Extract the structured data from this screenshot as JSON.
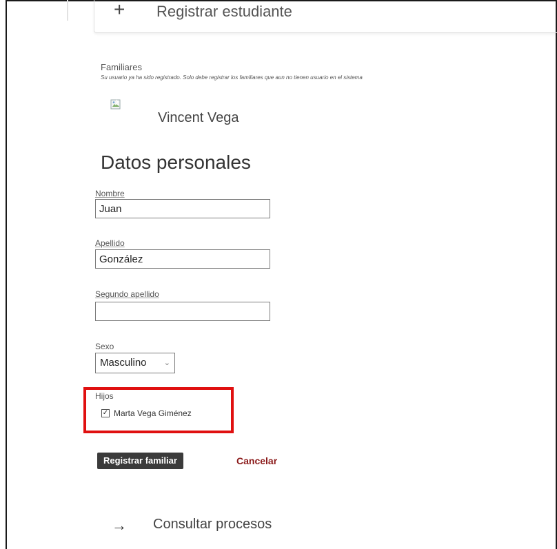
{
  "top_card": {
    "label": "Registrar estudiante"
  },
  "familiares": {
    "title": "Familiares",
    "note": "Su usuario ya ha sido registrado. Solo debe registrar los familiares que aun no tienen usuario en el sistema"
  },
  "member": {
    "name": "Vincent Vega"
  },
  "section_title": "Datos personales",
  "fields": {
    "nombre": {
      "label": "Nombre",
      "value": "Juan"
    },
    "apellido": {
      "label": "Apellido",
      "value": "González"
    },
    "segundo_apellido": {
      "label": "Segundo apellido",
      "value": ""
    }
  },
  "sexo": {
    "label": "Sexo",
    "selected": "Masculino"
  },
  "hijos": {
    "label": "Hijos",
    "items": [
      {
        "name": "Marta Vega Giménez",
        "checked": true
      }
    ]
  },
  "actions": {
    "submit_label": "Registrar familiar",
    "cancel_label": "Cancelar"
  },
  "next_link": {
    "label": "Consultar procesos"
  },
  "colors": {
    "highlight": "#e01010",
    "cancel": "#8b1a1a",
    "button_bg": "#3b3b3b"
  },
  "icons": {
    "add": "plus-icon",
    "next": "arrow-right-icon",
    "dropdown": "chevron-down-icon",
    "check": "checkmark-icon",
    "image": "broken-image-icon"
  }
}
